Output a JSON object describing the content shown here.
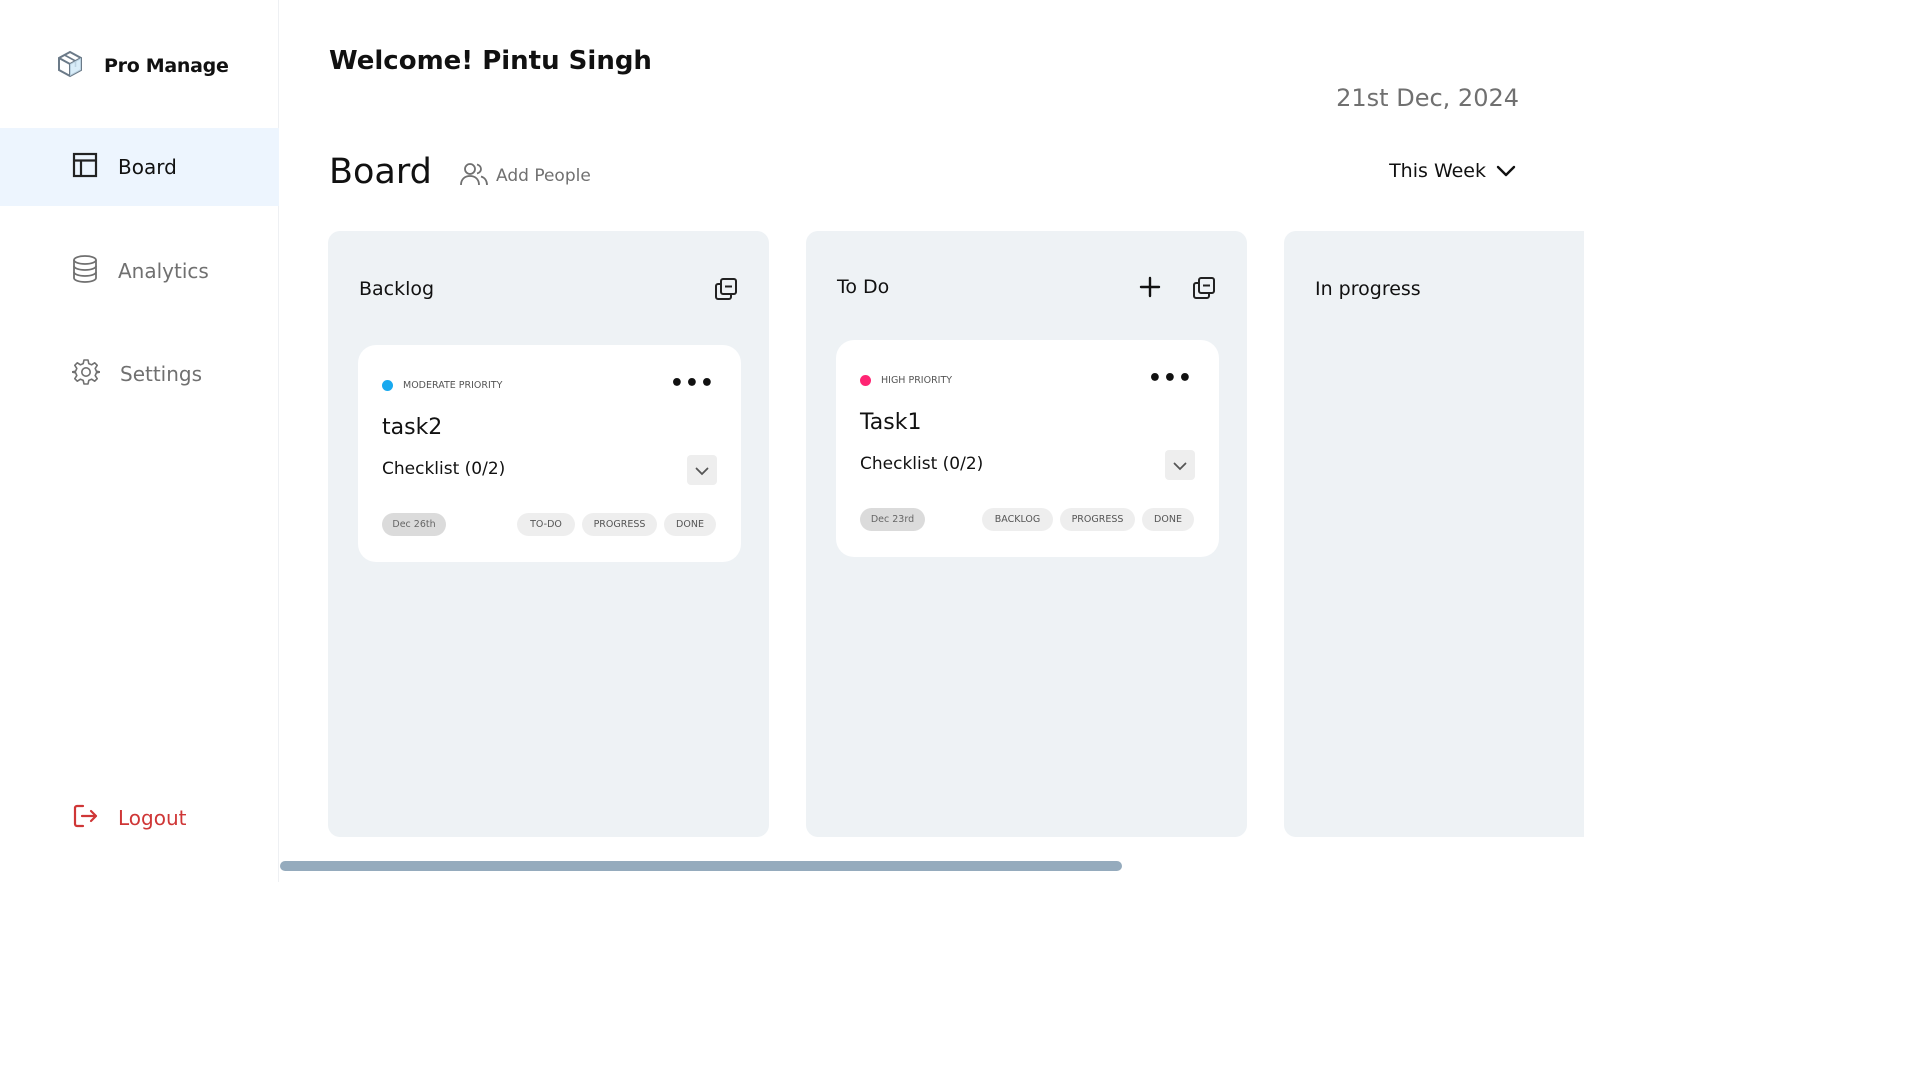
{
  "app": {
    "name": "Pro Manage"
  },
  "sidebar": {
    "items": [
      {
        "label": "Board",
        "icon": "board-icon",
        "active": true
      },
      {
        "label": "Analytics",
        "icon": "database-icon",
        "active": false
      },
      {
        "label": "Settings",
        "icon": "gear-icon",
        "active": false
      }
    ],
    "logout_label": "Logout"
  },
  "header": {
    "welcome": "Welcome! Pintu Singh",
    "date": "21st Dec, 2024",
    "board_title": "Board",
    "add_people_label": "Add People",
    "filter_label": "This Week"
  },
  "columns": [
    {
      "title": "Backlog",
      "cards": [
        {
          "priority": "MODERATE PRIORITY",
          "priority_color": "#18a9ef",
          "title": "task2",
          "checklist": "Checklist (0/2)",
          "due": "Dec 26th",
          "moves": [
            "TO-DO",
            "PROGRESS",
            "DONE"
          ]
        }
      ]
    },
    {
      "title": "To Do",
      "cards": [
        {
          "priority": "HIGH PRIORITY",
          "priority_color": "#ff2473",
          "title": "Task1",
          "checklist": "Checklist (0/2)",
          "due": "Dec 23rd",
          "moves": [
            "BACKLOG",
            "PROGRESS",
            "DONE"
          ]
        }
      ]
    },
    {
      "title": "In progress",
      "cards": []
    }
  ],
  "colors": {
    "active_nav_bg": "#edf5fe",
    "column_bg": "#eef2f5",
    "logout": "#cf3636",
    "scrollbar": "#95abbd"
  }
}
